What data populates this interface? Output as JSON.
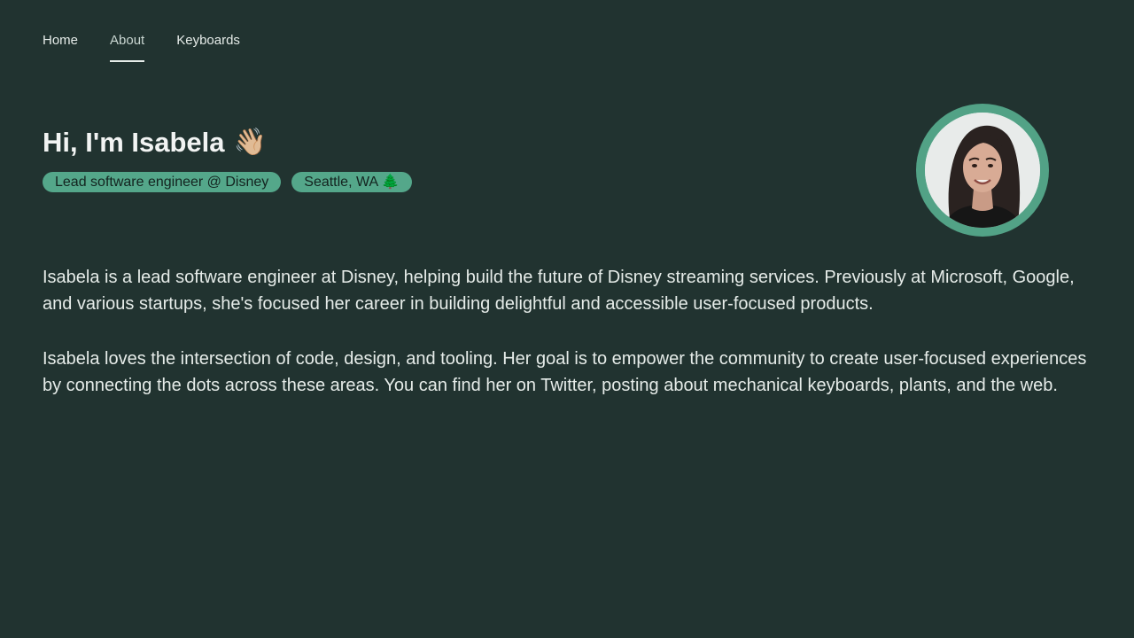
{
  "nav": {
    "items": [
      {
        "label": "Home"
      },
      {
        "label": "About"
      },
      {
        "label": "Keyboards"
      }
    ],
    "active": "About"
  },
  "hero": {
    "title": "Hi, I'm Isabela",
    "title_emoji": "👋🏼",
    "tags": [
      {
        "label": "Lead software engineer @ Disney"
      },
      {
        "label": "Seattle, WA 🌲"
      }
    ]
  },
  "avatar": {
    "description_icon": "profile-photo",
    "ring_color": "#52a286"
  },
  "bio": {
    "paragraphs": [
      "Isabela is a lead software engineer at Disney, helping build the future of Disney streaming services. Previously at Microsoft, Google, and various startups, she's focused her career in building delightful and accessible user-focused products.",
      "Isabela loves the intersection of code, design, and tooling. Her goal is to empower the community to create user-focused experiences by connecting the dots across these areas. You can find her on Twitter, posting about mechanical keyboards, plants, and the web."
    ]
  },
  "colors": {
    "background": "#213330",
    "accent": "#54a78a",
    "text": "#e6ece9"
  }
}
